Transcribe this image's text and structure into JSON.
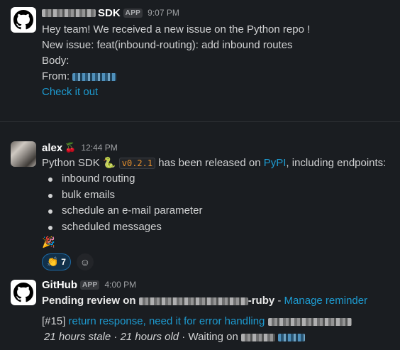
{
  "messages": {
    "sdk_bot": {
      "name_suffix": "SDK",
      "badge": "APP",
      "time": "9:07 PM",
      "lines": [
        "Hey team! We received a new issue on the Python repo !",
        "New issue: feat(inbound-routing): add inbound routes",
        "Body:"
      ],
      "from_label": "From:",
      "link": "Check it out"
    },
    "alex": {
      "name": "alex",
      "status_emoji": "🍒",
      "time": "12:44 PM",
      "text_before": "Python SDK",
      "snake_emoji": "🐍",
      "version": "v0.2.1",
      "text_mid": "has been released on",
      "pypi": "PyPI",
      "text_after": ", including endpoints:",
      "bullets": [
        "inbound routing",
        "bulk emails",
        "schedule an e-mail parameter",
        "scheduled messages"
      ],
      "party_emoji": "🎉",
      "reaction_emoji": "👏",
      "reaction_count": "7",
      "add_reaction_icon": "☺"
    },
    "github": {
      "name": "GitHub",
      "badge": "APP",
      "time": "4:00 PM",
      "pending_label": "Pending review on",
      "repo_suffix": "-ruby",
      "separator": " - ",
      "manage": "Manage reminder",
      "pr_number": "[#15]",
      "pr_title": "return response, need it for error handling",
      "stale": "21 hours stale",
      "dot": " · ",
      "old": "21 hours old",
      "waiting": "Waiting on"
    }
  },
  "colors": {
    "background": "#1a1d21",
    "link": "#1d9bd1",
    "code": "#e8912d",
    "reaction_border": "#1d6aa5"
  }
}
